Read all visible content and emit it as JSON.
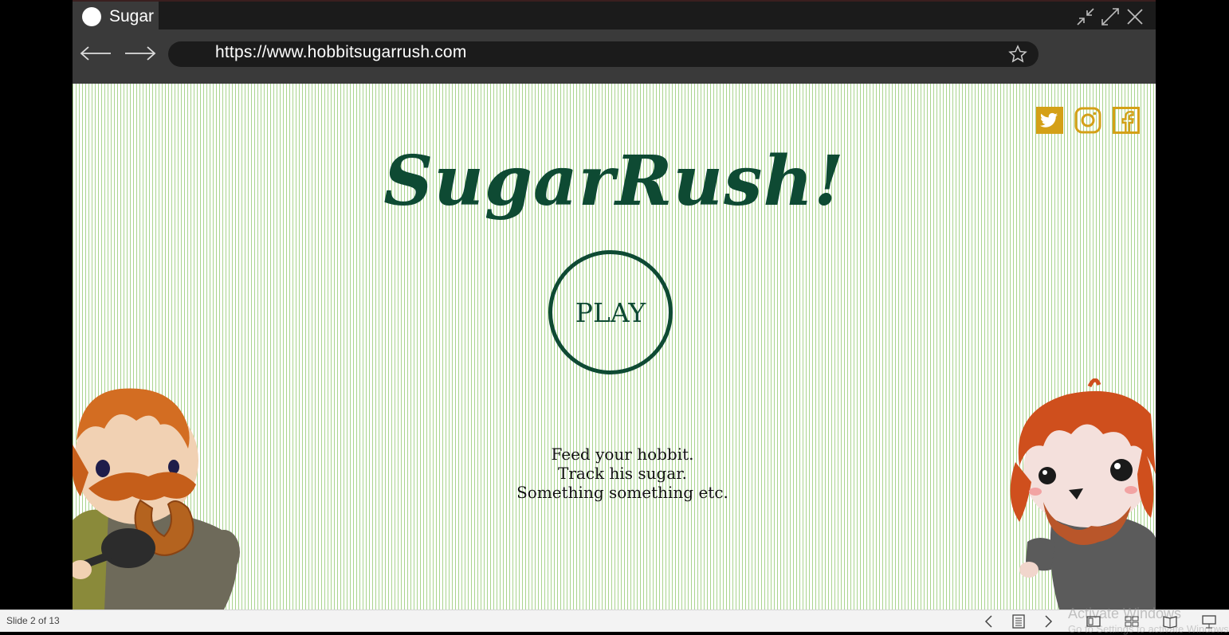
{
  "browser": {
    "tab_title": "Sugar",
    "url": "https://www.hobbitsugarrush.com"
  },
  "page": {
    "title": "SugarRush!",
    "play_label": "PLAY",
    "tagline": [
      "Feed your hobbit.",
      "Track his sugar.",
      "Something something etc."
    ],
    "social_icons": [
      "twitter-icon",
      "instagram-icon",
      "facebook-icon"
    ]
  },
  "status_bar": {
    "slide_info": "Slide 2 of 13",
    "watermark_line1": "Activate Windows",
    "watermark_line2": "Go to Settings to activate Windows."
  },
  "colors": {
    "title_green": "#0e4a33",
    "stripe_green": "#a9d48e",
    "social_gold": "#d4a017",
    "browser_dark": "#1b1b1b",
    "browser_gray": "#3a3a3a"
  }
}
